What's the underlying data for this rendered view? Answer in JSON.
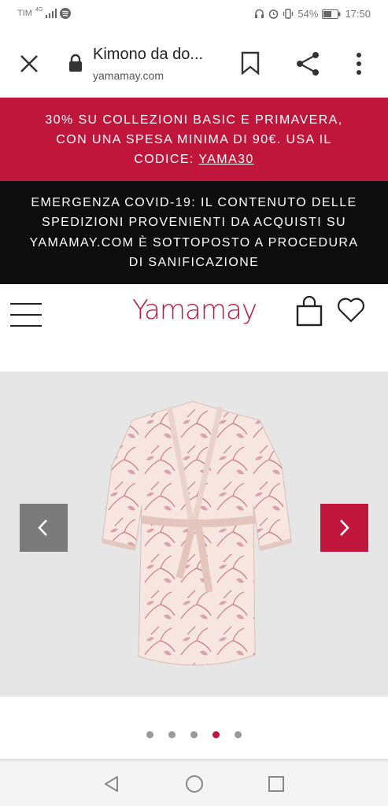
{
  "status_bar": {
    "carrier": "TIM",
    "network": "4G",
    "battery": "54%",
    "time": "17:50"
  },
  "browser": {
    "page_title": "Kimono da do...",
    "url": "yamamay.com"
  },
  "promo_banner": {
    "line1": "30% SU COLLEZIONI BASIC E PRIMAVERA,",
    "line2": "CON UNA SPESA MINIMA DI 90€. USA IL",
    "line3_prefix": "CODICE: ",
    "code": "YAMA30",
    "background": "#c0163c"
  },
  "covid_banner": {
    "line1": "EMERGENZA COVID-19: IL CONTENUTO DELLE",
    "line2": "SPEDIZIONI PROVENIENTI DA ACQUISTI SU",
    "line3": "YAMAMAY.COM È SOTTOPOSTO A PROCEDURA",
    "line4": "DI SANIFICAZIONE",
    "background": "#0d0d0d"
  },
  "header": {
    "logo": "Yamamay",
    "accent_color": "#c0163c"
  },
  "gallery": {
    "image_count": 5,
    "active_index": 3,
    "product_image": "pink floral kimono robe"
  },
  "icons": {
    "close": "close-icon",
    "lock": "lock-icon",
    "bookmark": "bookmark-icon",
    "share": "share-icon",
    "menu": "more-vert-icon",
    "hamburger": "hamburger-icon",
    "bag": "shopping-bag-icon",
    "heart": "heart-icon",
    "prev": "chevron-left-icon",
    "next": "chevron-right-icon",
    "nav_back": "back-triangle-icon",
    "nav_home": "home-circle-icon",
    "nav_recents": "recents-square-icon"
  }
}
